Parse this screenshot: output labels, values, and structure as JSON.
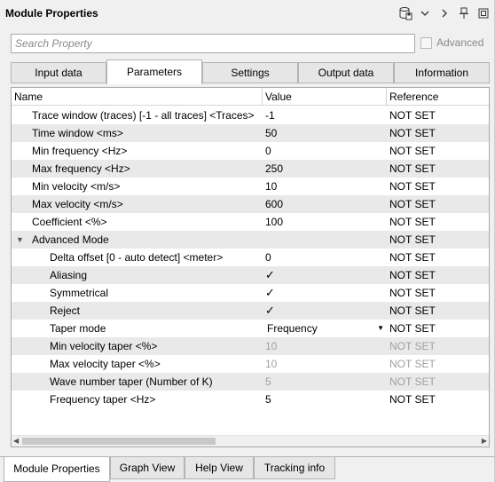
{
  "header": {
    "title": "Module Properties",
    "icons": [
      "save-db-icon",
      "chevron-down-icon",
      "chevron-right-icon",
      "pin-icon",
      "restore-window-icon"
    ]
  },
  "search": {
    "placeholder": "Search Property",
    "value": ""
  },
  "advanced": {
    "label": "Advanced",
    "checked": false
  },
  "tabs": [
    {
      "label": "Input data",
      "active": false
    },
    {
      "label": "Parameters",
      "active": true
    },
    {
      "label": "Settings",
      "active": false
    },
    {
      "label": "Output data",
      "active": false
    },
    {
      "label": "Information",
      "active": false
    }
  ],
  "grid": {
    "columns": {
      "name": "Name",
      "value": "Value",
      "reference": "Reference"
    },
    "rows": [
      {
        "name": "Trace window (traces) [-1 - all traces] <Traces>",
        "value": "-1",
        "reference": "NOT SET"
      },
      {
        "name": "Time window <ms>",
        "value": "50",
        "reference": "NOT SET"
      },
      {
        "name": "Min frequency <Hz>",
        "value": "0",
        "reference": "NOT SET"
      },
      {
        "name": "Max frequency <Hz>",
        "value": "250",
        "reference": "NOT SET"
      },
      {
        "name": "Min velocity <m/s>",
        "value": "10",
        "reference": "NOT SET"
      },
      {
        "name": "Max velocity <m/s>",
        "value": "600",
        "reference": "NOT SET"
      },
      {
        "name": "Coefficient <%>",
        "value": "100",
        "reference": "NOT SET"
      },
      {
        "name": "Advanced Mode",
        "value": "",
        "reference": "NOT SET"
      },
      {
        "name": "Delta offset [0 - auto detect] <meter>",
        "value": "0",
        "reference": "NOT SET"
      },
      {
        "name": "Aliasing",
        "value": "✓",
        "reference": "NOT SET"
      },
      {
        "name": "Symmetrical",
        "value": "✓",
        "reference": "NOT SET"
      },
      {
        "name": "Reject",
        "value": "✓",
        "reference": "NOT SET"
      },
      {
        "name": "Taper mode",
        "value": "Frequency",
        "reference": "NOT SET"
      },
      {
        "name": "Min velocity taper <%>",
        "value": "10",
        "reference": "NOT SET"
      },
      {
        "name": "Max velocity taper <%>",
        "value": "10",
        "reference": "NOT SET"
      },
      {
        "name": "Wave number taper (Number of K)",
        "value": "5",
        "reference": "NOT SET"
      },
      {
        "name": "Frequency taper <Hz>",
        "value": "5",
        "reference": "NOT SET"
      }
    ]
  },
  "bottom_tabs": [
    {
      "label": "Module Properties",
      "active": true
    },
    {
      "label": "Graph View",
      "active": false
    },
    {
      "label": "Help View",
      "active": false
    },
    {
      "label": "Tracking info",
      "active": false
    }
  ]
}
